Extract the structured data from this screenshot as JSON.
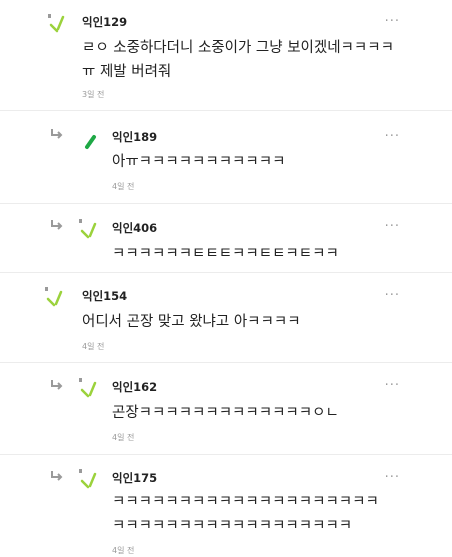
{
  "comments": [
    {
      "author": "익인129",
      "lines": [
        "ㄹㅇ 소중하다더니 소중이가 그냥 보이겠네ㅋㅋㅋㅋ",
        "ㅠ 제발 버려줘"
      ],
      "time": "3일 전",
      "more": "···"
    },
    {
      "author": "익인189",
      "lines": [
        "아ㅠㅋㅋㅋㅋㅋㅋㅋㅋㅋㅋㅋ"
      ],
      "time": "4일 전",
      "more": "···"
    },
    {
      "author": "익인406",
      "lines": [
        "ㅋㅋㅋㅋㅋㅋㅌㅌㅌㅋㅋㅌㅌㅋㅌㅋㅋ"
      ],
      "time": "",
      "more": "···"
    },
    {
      "author": "익인154",
      "lines": [
        "어디서 곤장 맞고 왔냐고 아ㅋㅋㅋㅋ"
      ],
      "time": "4일 전",
      "more": "···"
    },
    {
      "author": "익인162",
      "lines": [
        "곤장ㅋㅋㅋㅋㅋㅋㅋㅋㅋㅋㅋㅋㅋㅇㄴ"
      ],
      "time": "4일 전",
      "more": "···"
    },
    {
      "author": "익인175",
      "lines": [
        "ㅋㅋㅋㅋㅋㅋㅋㅋㅋㅋㅋㅋㅋㅋㅋㅋㅋㅋㅋㅋ",
        "ㅋㅋㅋㅋㅋㅋㅋㅋㅋㅋㅋㅋㅋㅋㅋㅋㅋㅋ"
      ],
      "time": "4일 전",
      "more": "···"
    }
  ],
  "colors": {
    "accent": "#9bd23c",
    "accent_dark": "#1ea845",
    "meta": "#9a9a9a",
    "text": "#222222"
  },
  "icons": {
    "reply": "reply-arrow-icon",
    "avatar": "cheer-stick-avatar-icon",
    "more": "more-dots-icon"
  }
}
